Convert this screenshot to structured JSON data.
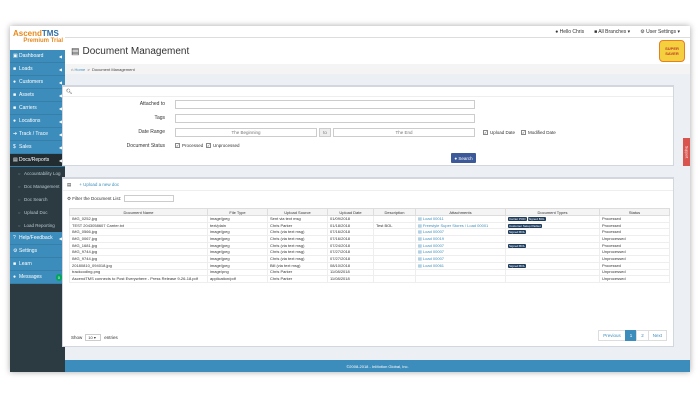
{
  "brand": {
    "name_main": "Ascend",
    "name_accent": "TMS",
    "subtitle": "Premium Trial"
  },
  "topbar": {
    "user": "Hello Chris",
    "branches": "All Branches",
    "settings": "User Settings"
  },
  "sidebar": {
    "items": [
      {
        "label": "Dashboard",
        "icon": "dashboard-icon",
        "glyph": "▣"
      },
      {
        "label": "Loads",
        "icon": "truck-icon",
        "glyph": "■"
      },
      {
        "label": "Customers",
        "icon": "users-icon",
        "glyph": "●"
      },
      {
        "label": "Assets",
        "icon": "box-icon",
        "glyph": "■"
      },
      {
        "label": "Carriers",
        "icon": "carrier-icon",
        "glyph": "■"
      },
      {
        "label": "Locations",
        "icon": "map-marker-icon",
        "glyph": "●"
      },
      {
        "label": "Track / Trace",
        "icon": "route-icon",
        "glyph": "➔"
      },
      {
        "label": "Sales",
        "icon": "dollar-icon",
        "glyph": "$"
      },
      {
        "label": "Docs/Reports",
        "icon": "file-icon",
        "glyph": "▤"
      }
    ],
    "subitems": [
      {
        "label": "Accountability Log"
      },
      {
        "label": "Doc Management"
      },
      {
        "label": "Doc Search"
      },
      {
        "label": "Upload Doc"
      },
      {
        "label": "Load Reporting"
      }
    ],
    "bottom": [
      {
        "label": "Help/Feedback",
        "icon": "help-icon",
        "glyph": "?"
      },
      {
        "label": "Settings",
        "icon": "gear-icon",
        "glyph": "⚙"
      },
      {
        "label": "Learn",
        "icon": "learn-icon",
        "glyph": "■"
      },
      {
        "label": "Messages",
        "icon": "message-icon",
        "glyph": "●",
        "badge": "0"
      }
    ]
  },
  "header": {
    "title": "Document Management"
  },
  "breadcrumb": {
    "home": "Home",
    "current": "Document Management"
  },
  "search": {
    "attached_label": "Attached to",
    "tags_label": "Tags",
    "date_range_label": "Date Range",
    "date_start_placeholder": "The Beginning",
    "date_to": "to",
    "date_end_placeholder": "The End",
    "upload_date": "Upload Date",
    "modified_date": "Modified Date",
    "status_label": "Document Status",
    "processed": "Processed",
    "unprocessed": "Unprocessed",
    "button": "Search"
  },
  "list": {
    "upload_link": "Upload a new doc",
    "filter_label": "Filter the Document List:",
    "columns": [
      "Document Name",
      "File Type",
      "Upload Source",
      "Upload Date",
      "Description",
      "Attachments",
      "Document Types",
      "Status"
    ],
    "rows": [
      [
        "IMG_0252.jpg",
        "image/jpeg",
        "Sent via text msg",
        "01/09/2018",
        "",
        "Load 00011",
        [
          "Carrier POD",
          "Signed BOL"
        ],
        "Processed"
      ],
      [
        "TEST 2043058607 Carrier.txt",
        "text/plain",
        "Chris Parker",
        "01/18/2018",
        "Test BOL",
        "Freestyle Super Stores / Load 00001",
        [
          "Customer Setup Packet"
        ],
        "Processed"
      ],
      [
        "IMG_0566.jpg",
        "image/jpeg",
        "Chris (via text msg)",
        "07/16/2018",
        "",
        "Load 00007",
        [
          "Signed BOL"
        ],
        "Processed"
      ],
      [
        "IMG_0067.jpg",
        "image/jpeg",
        "Chris (via text msg)",
        "07/16/2018",
        "",
        "Load 00019",
        [],
        "Unprocessed"
      ],
      [
        "IMG_1681.jpg",
        "image/jpeg",
        "Chris (via text msg)",
        "07/24/2018",
        "",
        "Load 00007",
        [
          "Signed BOL"
        ],
        "Processed"
      ],
      [
        "IMG_9744.jpg",
        "image/jpeg",
        "Chris (via text msg)",
        "07/27/2018",
        "",
        "Load 00007",
        [],
        "Unprocessed"
      ],
      [
        "IMG_9744.jpg",
        "image/jpeg",
        "Chris (via text msg)",
        "07/27/2018",
        "",
        "Load 00007",
        [],
        "Unprocessed"
      ],
      [
        "20180810_094018.jpg",
        "image/jpeg",
        "Bill (via text msg)",
        "08/10/2018",
        "",
        "Load 00061",
        [
          "Signed BOL"
        ],
        "Processed"
      ],
      [
        "trackcoding.png",
        "image/png",
        "Chris Parker",
        "11/08/2018",
        "",
        "",
        [],
        "Unprocessed"
      ],
      [
        "AscendTMS connects to Post Everywhere - Press Release 9-26-18.pdf",
        "application/pdf",
        "Chris Parker",
        "11/08/2018",
        "",
        "",
        [],
        "Unprocessed"
      ]
    ],
    "show_label": "Show",
    "show_value": "10",
    "entries_label": "entries",
    "pager": {
      "previous": "Previous",
      "page1": "1",
      "page2": "2",
      "next": "Next"
    }
  },
  "footer": {
    "text": "©2008-2018 - InMotion Global, Inc."
  },
  "side_tab": {
    "label": "Support"
  },
  "mascot": {
    "text": "SUPER SAVER"
  },
  "colors": {
    "primary": "#3c8dbc",
    "sidebar": "#2c3b41",
    "button": "#3c5a99",
    "tag": "#1f3c5c"
  }
}
